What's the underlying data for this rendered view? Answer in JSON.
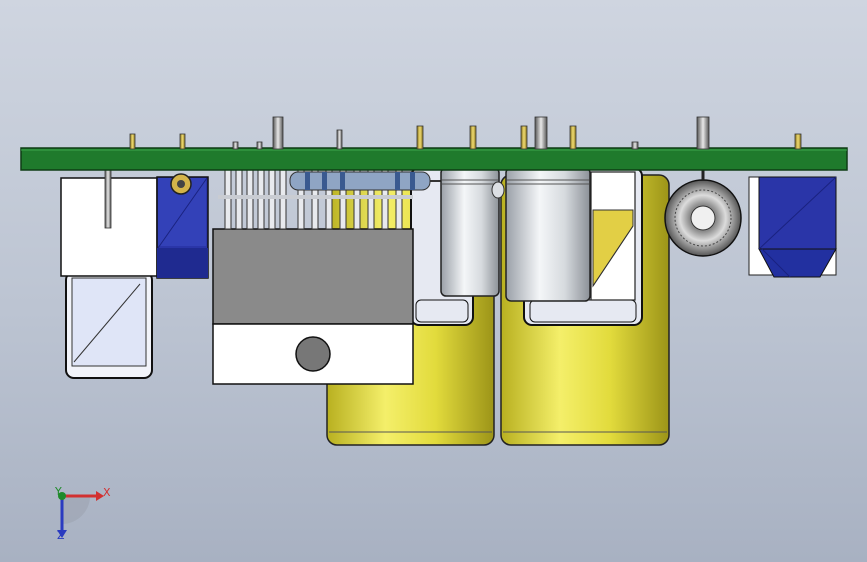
{
  "viewport": {
    "background_top": "#cfd5e0",
    "background_bottom": "#a8b1c2"
  },
  "board": {
    "color": "#1f7a2c"
  },
  "triad": {
    "x_label": "X",
    "y_label": "Y",
    "z_label": "Z",
    "x_color": "#d23030",
    "y_color": "#1f8a2a",
    "z_color": "#2a3bc0"
  },
  "components": {
    "large_capacitor_color": "#d9d43a",
    "heatsink_color": "#8a8a8a",
    "relay_color": "#2a35a8",
    "transistor_color": "#ffffff"
  }
}
